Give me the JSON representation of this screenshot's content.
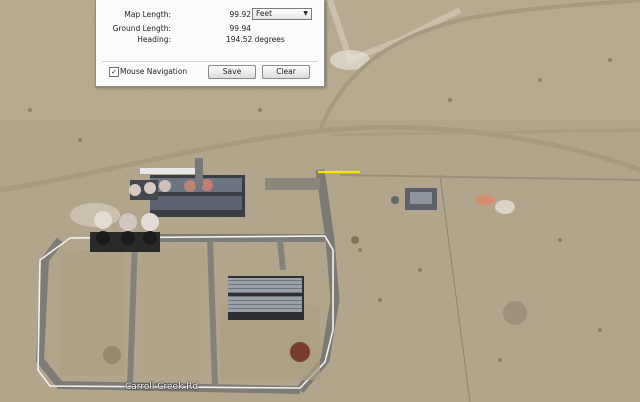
{
  "ruler_panel": {
    "map_length_label": "Map Length:",
    "map_length_value": "99.92",
    "unit_selected": "Feet",
    "ground_length_label": "Ground Length:",
    "ground_length_value": "99.94",
    "heading_label": "Heading:",
    "heading_value": "194.52 degrees",
    "mouse_navigation_label": "Mouse Navigation",
    "mouse_navigation_checked": true,
    "save_label": "Save",
    "clear_label": "Clear"
  },
  "map": {
    "road_label": "Carroll Creek Rd",
    "measure_line_color": "#f5e600"
  }
}
